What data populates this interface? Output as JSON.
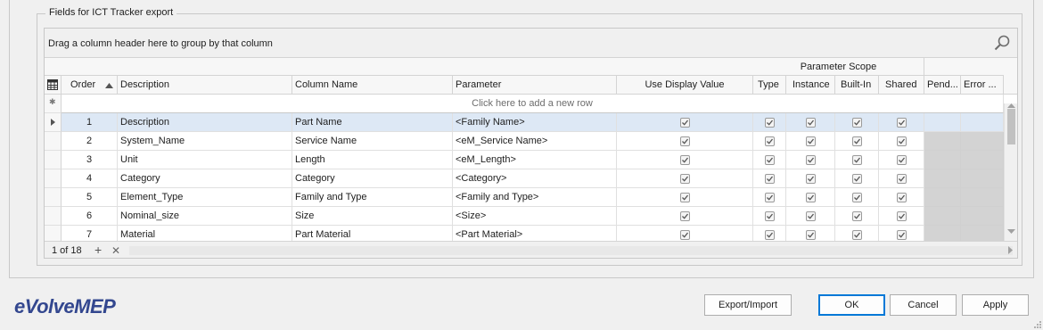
{
  "group_title": "Fields for ICT Tracker export",
  "grid": {
    "group_panel_text": "Drag a column header here to group by that column",
    "band_label": "Parameter Scope",
    "columns": {
      "order": "Order",
      "description": "Description",
      "column_name": "Column Name",
      "parameter": "Parameter",
      "use_display_value": "Use Display Value",
      "type": "Type",
      "instance": "Instance",
      "built_in": "Built-In",
      "shared": "Shared",
      "pending": "Pend...",
      "error": "Error ..."
    },
    "new_row_text": "Click here to add a new row",
    "rows": [
      {
        "order": "1",
        "description": "Description",
        "column_name": "Part Name",
        "parameter": "<Family Name>",
        "use_display_value": true,
        "type": true,
        "instance": true,
        "built_in": true,
        "shared": true
      },
      {
        "order": "2",
        "description": "System_Name",
        "column_name": "Service Name",
        "parameter": "<eM_Service Name>",
        "use_display_value": true,
        "type": true,
        "instance": true,
        "built_in": true,
        "shared": true
      },
      {
        "order": "3",
        "description": "Unit",
        "column_name": "Length",
        "parameter": "<eM_Length>",
        "use_display_value": true,
        "type": true,
        "instance": true,
        "built_in": true,
        "shared": true
      },
      {
        "order": "4",
        "description": "Category",
        "column_name": "Category",
        "parameter": "<Category>",
        "use_display_value": true,
        "type": true,
        "instance": true,
        "built_in": true,
        "shared": true
      },
      {
        "order": "5",
        "description": "Element_Type",
        "column_name": "Family and Type",
        "parameter": "<Family and Type>",
        "use_display_value": true,
        "type": true,
        "instance": true,
        "built_in": true,
        "shared": true
      },
      {
        "order": "6",
        "description": "Nominal_size",
        "column_name": "Size",
        "parameter": "<Size>",
        "use_display_value": true,
        "type": true,
        "instance": true,
        "built_in": true,
        "shared": true
      },
      {
        "order": "7",
        "description": "Material",
        "column_name": "Part Material",
        "parameter": "<Part Material>",
        "use_display_value": true,
        "type": true,
        "instance": true,
        "built_in": true,
        "shared": true
      }
    ],
    "record_count": "1 of 18",
    "add_symbol": "+",
    "delete_symbol": "✕",
    "new_row_symbol": "✱"
  },
  "buttons": {
    "export_import": "Export/Import",
    "ok": "OK",
    "cancel": "Cancel",
    "apply": "Apply"
  },
  "logo_text": "eVolveMEP",
  "colors": {
    "selection": "#dde8f5",
    "accent": "#0078d7",
    "logo": "#33478f",
    "disabled_cell": "#d3d3d3"
  }
}
